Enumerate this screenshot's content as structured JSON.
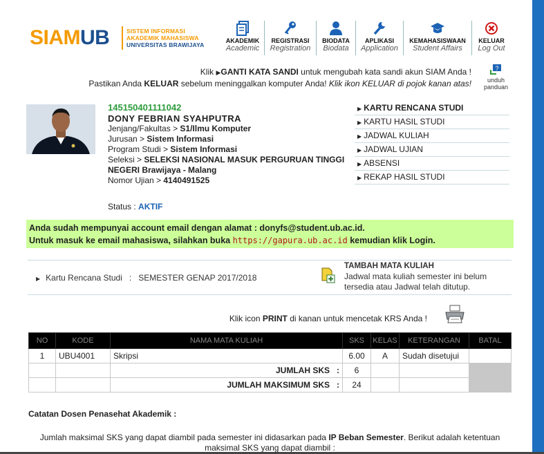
{
  "header": {
    "logo_siam": "SIAM",
    "logo_ub": "UB",
    "tagline1": "SISTEM INFORMASI",
    "tagline2": "AKADEMIK MAHASISWA",
    "tagline3": "UNIVERSITAS BRAWIJAYA",
    "nav": [
      {
        "label": "AKADEMIK",
        "sub": "Academic",
        "icon": "document-icon"
      },
      {
        "label": "REGISTRASI",
        "sub": "Registration",
        "icon": "key-icon"
      },
      {
        "label": "BIODATA",
        "sub": "Biodata",
        "icon": "person-icon"
      },
      {
        "label": "APLIKASI",
        "sub": "Application",
        "icon": "wrench-icon"
      },
      {
        "label": "KEMAHASISWAAN",
        "sub": "Student Affairs",
        "icon": "graduation-cap-icon"
      },
      {
        "label": "KELUAR",
        "sub": "Log Out",
        "icon": "close-icon"
      }
    ]
  },
  "notice": {
    "line1_pre": "Klik ",
    "line1_link": "GANTI KATA SANDI",
    "line1_post": " untuk mengubah kata sandi akun SIAM Anda !",
    "line2_pre": "Pastikan Anda ",
    "line2_bold": "KELUAR",
    "line2_mid": " sebelum meninggalkan komputer Anda! ",
    "line2_italic": "Klik ikon KELUAR di pojok kanan atas!",
    "unduh1": "unduh",
    "unduh2": "panduan"
  },
  "profile": {
    "nim": "145150401111042",
    "nama": "DONY FEBRIAN SYAHPUTRA",
    "jenjang_label": "Jenjang/Fakultas",
    "jenjang_value": "S1/Ilmu Komputer",
    "jurusan_label": "Jurusan",
    "jurusan_value": "Sistem Informasi",
    "prodi_label": "Program Studi",
    "prodi_value": "Sistem Informasi",
    "seleksi_label": "Seleksi",
    "seleksi_value1": "SELEKSI NASIONAL MASUK PERGURUAN TINGGI",
    "seleksi_value2": "NEGERI Brawijaya - Malang",
    "ujian_label": "Nomor Ujian",
    "ujian_value": "4140491525",
    "status_label": "Status : ",
    "status_value": "AKTIF"
  },
  "menu": [
    "KARTU RENCANA STUDI",
    "KARTU HASIL STUDI",
    "JADWAL KULIAH",
    "JADWAL UJIAN",
    "ABSENSI",
    "REKAP HASIL STUDI"
  ],
  "email": {
    "line1": "Anda sudah mempunyai account email dengan alamat : donyfs@student.ub.ac.id.",
    "line2_pre": "Untuk masuk ke email mahasiswa, silahkan buka ",
    "line2_link": "https://gapura.ub.ac.id",
    "line2_post": " kemudian klik Login."
  },
  "krs": {
    "label": "Kartu Rencana Studi   :   SEMESTER GENAP 2017/2018",
    "tambah_title": "TAMBAH MATA KULIAH",
    "tambah_desc1": "Jadwal mata kuliah semester ini belum",
    "tambah_desc2": "tersedia atau Jadwal telah ditutup."
  },
  "print": {
    "pre": "Klik icon ",
    "bold": "PRINT",
    "post": " di kanan untuk mencetak KRS Anda !"
  },
  "table": {
    "headers": [
      "NO",
      "KODE",
      "NAMA MATA KULIAH",
      "SKS",
      "KELAS",
      "KETERANGAN",
      "BATAL"
    ],
    "rows": [
      {
        "no": "1",
        "kode": "UBU4001",
        "nama": "Skripsi",
        "sks": "6.00",
        "kelas": "A",
        "ket": "Sudah disetujui"
      }
    ],
    "jumlah_label": "JUMLAH SKS   :",
    "jumlah_value": "6",
    "max_label": "JUMLAH MAKSIMUM SKS   :",
    "max_value": "24"
  },
  "catatan": {
    "title": "Catatan Dosen Penasehat Akademik :",
    "line1_pre": "Jumlah maksimal SKS yang dapat diambil pada semester ini didasarkan pada ",
    "line1_bold": "IP Beban Semester",
    "line1_post": ". Berikut adalah ketentuan",
    "line2": "maksimal SKS yang dapat diambil :"
  },
  "colors": {
    "brand_orange": "#f49a00",
    "brand_blue": "#1c4f8e",
    "green_nim": "#2e9b3d",
    "email_bg": "#ccff99"
  }
}
